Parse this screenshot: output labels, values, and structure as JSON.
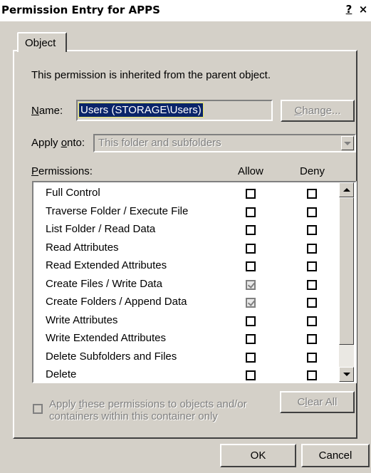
{
  "window": {
    "title": "Permission Entry for APPS",
    "help_glyph": "?",
    "close_glyph": "×"
  },
  "tabs": [
    {
      "label": "Object",
      "active": true
    }
  ],
  "inherited_message": "This permission is inherited from the parent object.",
  "name_field": {
    "label": "Name:",
    "value": "Users (STORAGE\\Users)"
  },
  "change_button": "Change...",
  "apply_onto": {
    "label": "Apply onto:",
    "value": "This folder and subfolders",
    "enabled": false
  },
  "permissions": {
    "header": "Permissions:",
    "allow_header": "Allow",
    "deny_header": "Deny",
    "rows": [
      {
        "name": "Full Control",
        "allow": false,
        "deny": false
      },
      {
        "name": "Traverse Folder / Execute File",
        "allow": false,
        "deny": false
      },
      {
        "name": "List Folder / Read Data",
        "allow": false,
        "deny": false
      },
      {
        "name": "Read Attributes",
        "allow": false,
        "deny": false
      },
      {
        "name": "Read Extended Attributes",
        "allow": false,
        "deny": false
      },
      {
        "name": "Create Files / Write Data",
        "allow": true,
        "deny": false
      },
      {
        "name": "Create Folders / Append Data",
        "allow": true,
        "deny": false
      },
      {
        "name": "Write Attributes",
        "allow": false,
        "deny": false
      },
      {
        "name": "Write Extended Attributes",
        "allow": false,
        "deny": false
      },
      {
        "name": "Delete Subfolders and Files",
        "allow": false,
        "deny": false
      },
      {
        "name": "Delete",
        "allow": false,
        "deny": false
      }
    ]
  },
  "apply_checkbox": {
    "line1": "Apply these permissions to objects and/or",
    "line2": "containers within this container only",
    "checked": false,
    "enabled": false
  },
  "clear_all_button": "Clear All",
  "ok_button": "OK",
  "cancel_button": "Cancel"
}
